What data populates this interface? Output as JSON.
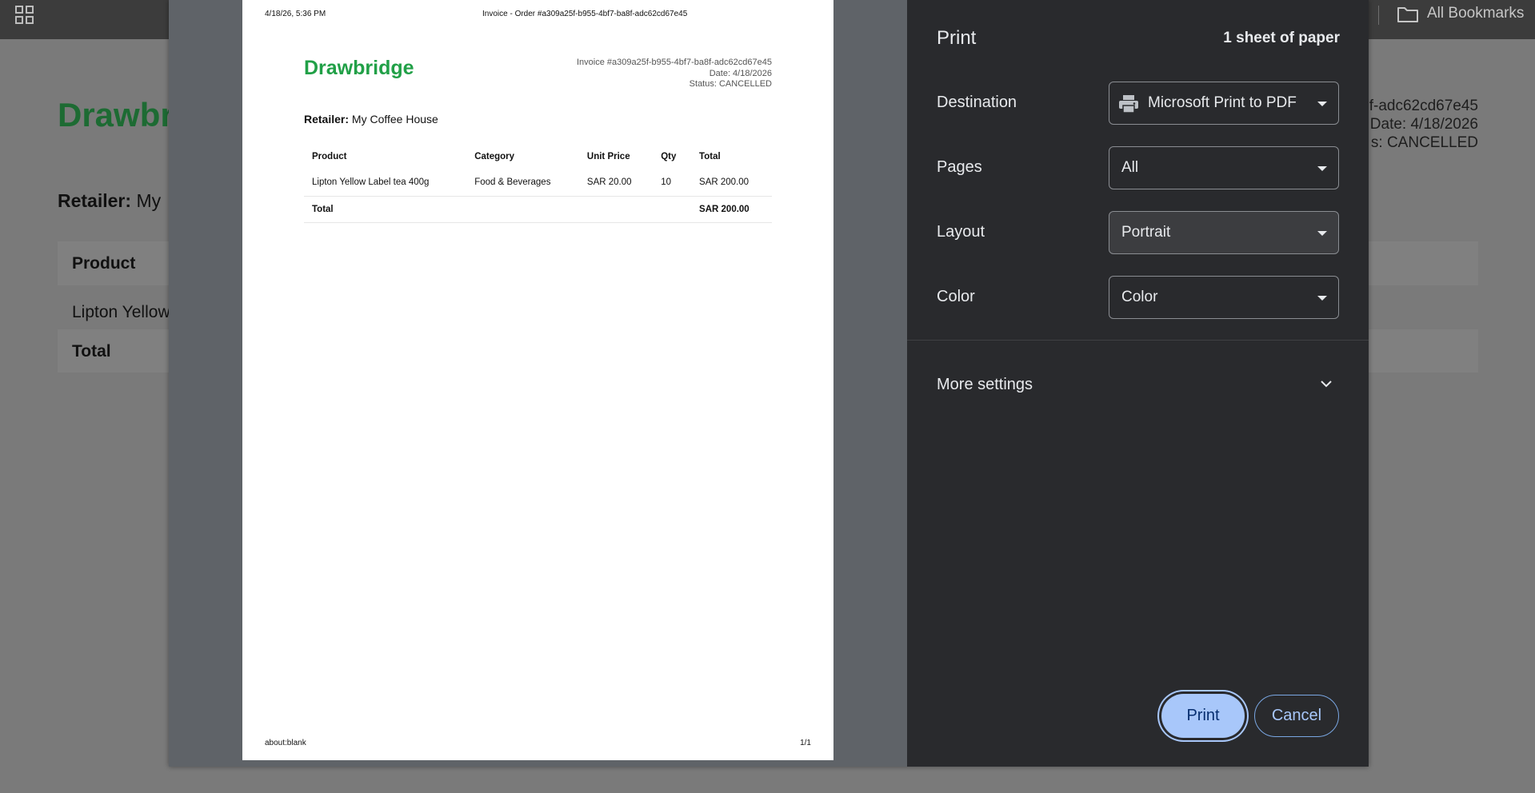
{
  "browser": {
    "bookmarks_label": "All Bookmarks",
    "apps_icon": "apps-grid-icon",
    "folder_icon": "folder-icon"
  },
  "background_page": {
    "brand": "Drawbr",
    "meta_lines": [
      "f-adc62cd67e45",
      "Date: 4/18/2026",
      "s: CANCELLED"
    ],
    "retailer_label": "Retailer:",
    "retailer_value": "My",
    "table_header": "Product",
    "table_item": "Lipton Yellow",
    "table_total": "Total"
  },
  "preview": {
    "header_left": "4/18/26, 5:36 PM",
    "header_center": "Invoice - Order #a309a25f-b955-4bf7-ba8f-adc62cd67e45",
    "brand": "Drawbridge",
    "invoice_number": "Invoice #a309a25f-b955-4bf7-ba8f-adc62cd67e45",
    "date": "Date: 4/18/2026",
    "status": "Status: CANCELLED",
    "retailer_label": "Retailer:",
    "retailer_value": "My Coffee House",
    "columns": [
      "Product",
      "Category",
      "Unit Price",
      "Qty",
      "Total"
    ],
    "rows": [
      [
        "Lipton Yellow Label tea 400g",
        "Food & Beverages",
        "SAR 20.00",
        "10",
        "SAR 200.00"
      ]
    ],
    "total_label": "Total",
    "total_value": "SAR 200.00",
    "footer_left": "about:blank",
    "footer_right": "1/1"
  },
  "print_panel": {
    "title": "Print",
    "sheet_count": "1 sheet of paper",
    "destination_label": "Destination",
    "destination_value": "Microsoft Print to PDF",
    "destination_icon": "printer-icon",
    "pages_label": "Pages",
    "pages_value": "All",
    "layout_label": "Layout",
    "layout_value": "Portrait",
    "color_label": "Color",
    "color_value": "Color",
    "more_settings_label": "More settings",
    "print_button": "Print",
    "cancel_button": "Cancel",
    "accent_color": "#a8c7fa"
  }
}
